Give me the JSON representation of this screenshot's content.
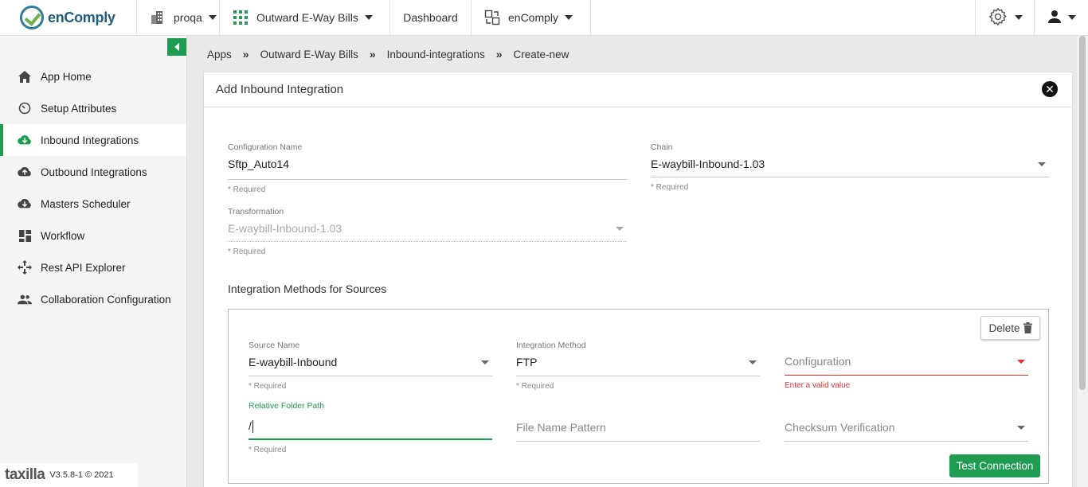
{
  "topbar": {
    "brand": "enComply",
    "org": "proqa",
    "app": "Outward E-Way Bills",
    "dashboard": "Dashboard",
    "product": "enComply"
  },
  "sidebar": {
    "items": [
      {
        "label": "App Home",
        "icon": "home-icon"
      },
      {
        "label": "Setup Attributes",
        "icon": "timer-icon"
      },
      {
        "label": "Inbound Integrations",
        "icon": "cloud-download-icon"
      },
      {
        "label": "Outbound Integrations",
        "icon": "cloud-upload-icon"
      },
      {
        "label": "Masters Scheduler",
        "icon": "cloud-download-icon"
      },
      {
        "label": "Workflow",
        "icon": "dashboard-grid-icon"
      },
      {
        "label": "Rest API Explorer",
        "icon": "move-arrows-icon"
      },
      {
        "label": "Collaboration Configuration",
        "icon": "people-icon"
      }
    ],
    "active_index": 2,
    "footer_logo": "taxilla",
    "footer_version": "V3.5.8-1 © 2021"
  },
  "breadcrumb": [
    "Apps",
    "Outward E-Way Bills",
    "Inbound-integrations",
    "Create-new"
  ],
  "breadcrumb_sep": "»",
  "panel": {
    "title": "Add Inbound Integration",
    "config_name": {
      "label": "Configuration Name",
      "value": "Sftp_Auto14",
      "hint": "* Required"
    },
    "chain": {
      "label": "Chain",
      "value": "E-waybill-Inbound-1.03",
      "hint": "* Required"
    },
    "transformation": {
      "label": "Transformation",
      "value": "E-waybill-Inbound-1.03",
      "hint": "* Required"
    },
    "section_title": "Integration Methods for Sources",
    "delete_label": "Delete",
    "source_name": {
      "label": "Source Name",
      "value": "E-waybill-Inbound",
      "hint": "* Required"
    },
    "integration_method": {
      "label": "Integration Method",
      "value": "FTP",
      "hint": "* Required"
    },
    "configuration": {
      "placeholder": "Configuration",
      "error": "Enter a valid value"
    },
    "relative_path": {
      "label": "Relative Folder Path",
      "value": "/",
      "hint": "* Required"
    },
    "file_pattern": {
      "placeholder": "File Name Pattern"
    },
    "checksum": {
      "placeholder": "Checksum Verification"
    },
    "test_label": "Test Connection"
  },
  "colors": {
    "accent": "#1e9d52",
    "error": "#e0302d",
    "brand": "#1f5f7a"
  }
}
